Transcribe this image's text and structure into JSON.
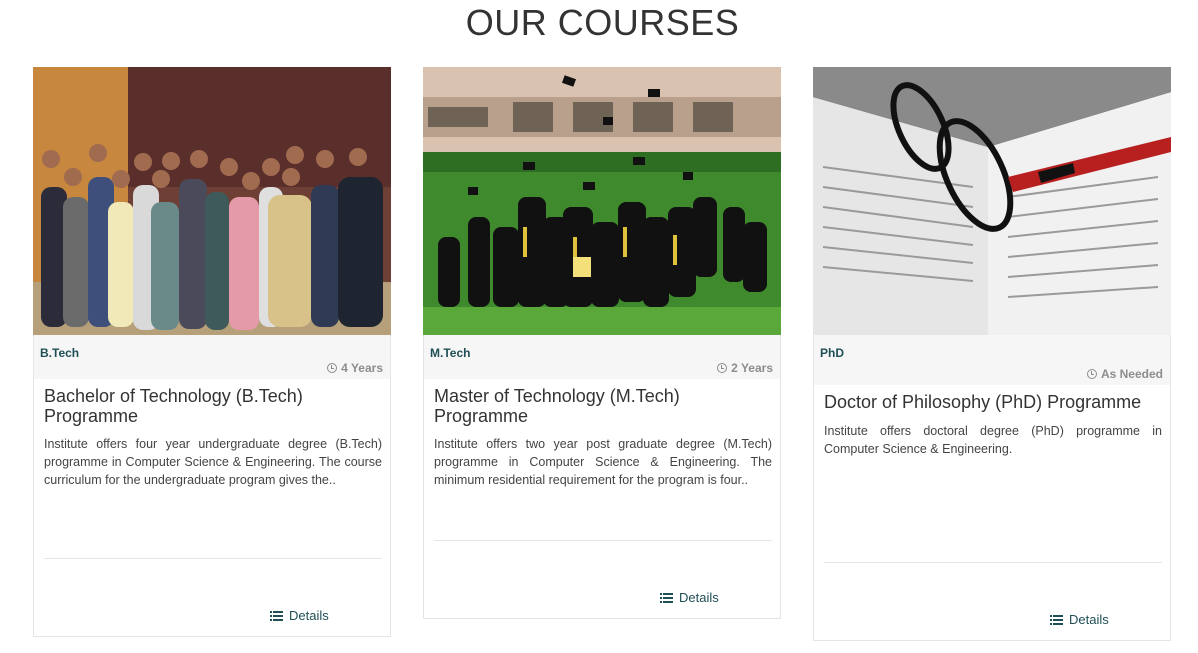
{
  "page_title": "OUR COURSES",
  "details_label": "Details",
  "courses": [
    {
      "category": "B.Tech",
      "duration": "4 Years",
      "title": "Bachelor of Technology (B.Tech) Programme",
      "description": "Institute offers four year undergraduate degree (B.Tech) programme in Computer Science & Engineering. The course curriculum for the undergraduate program gives the.."
    },
    {
      "category": "M.Tech",
      "duration": "2 Years",
      "title": "Master of Technology (M.Tech) Programme",
      "description": "Institute offers two year post graduate degree (M.Tech) programme in Computer Science & Engineering. The minimum residential requirement for the program is four.."
    },
    {
      "category": "PhD",
      "duration": "As Needed",
      "title": "Doctor of Philosophy (PhD) Programme",
      "description": "Institute offers doctoral degree (PhD) programme in Computer Science & Engineering."
    }
  ]
}
